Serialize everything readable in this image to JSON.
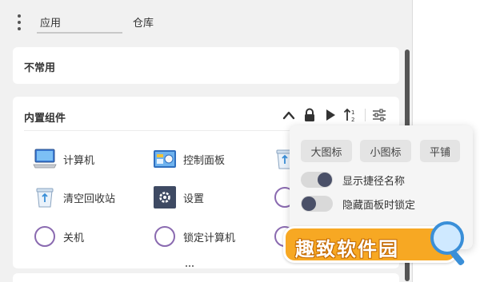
{
  "tabs": [
    {
      "label": "应用",
      "active": true
    },
    {
      "label": "仓库",
      "active": false
    }
  ],
  "sections": {
    "uncommon": {
      "title": "不常用"
    },
    "builtin": {
      "title": "内置组件",
      "header_icons": [
        "chevron-up-icon",
        "lock-icon",
        "play-icon",
        "sort-icon",
        "settings-sliders-icon"
      ],
      "items": [
        {
          "label": "计算机",
          "icon": "computer-icon"
        },
        {
          "label": "控制面板",
          "icon": "control-panel-icon"
        },
        {
          "label": "",
          "icon": "recycle-bin-icon"
        },
        {
          "label": "清空回收站",
          "icon": "recycle-bin-icon"
        },
        {
          "label": "设置",
          "icon": "settings-gear-icon"
        },
        {
          "label": "",
          "icon": "ring-icon"
        },
        {
          "label": "关机",
          "icon": "ring-icon"
        },
        {
          "label": "锁定计算机",
          "icon": "ring-icon"
        },
        {
          "label": "",
          "icon": "ring-icon"
        }
      ]
    }
  },
  "popup": {
    "size_buttons": [
      "大图标",
      "小图标",
      "平铺"
    ],
    "toggles": [
      {
        "label": "显示捷径名称",
        "on": true
      },
      {
        "label": "隐藏面板时锁定",
        "on": false
      }
    ]
  },
  "watermark": {
    "text": "趣致软件园"
  },
  "colors": {
    "panel_bg": "#f1f1f1",
    "card_bg": "#ffffff",
    "toggle_knob": "#4a5068",
    "watermark_orange": "#f7a823",
    "watermark_blue": "#3a8fd8"
  }
}
